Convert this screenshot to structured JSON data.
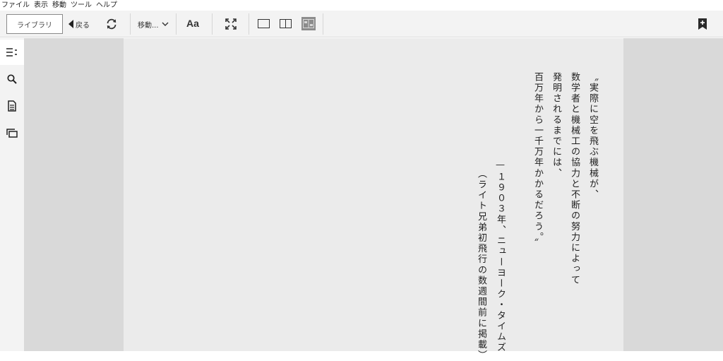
{
  "menu": [
    "ファイル",
    "表示",
    "移動",
    "ツール",
    "ヘルプ"
  ],
  "toolbar": {
    "library_label": "ライブラリ",
    "back_label": "戻る",
    "goto_label": "移動...",
    "font_label": "Aa"
  },
  "page_lines": {
    "line1": "〝実際に空を飛ぶ機械が、",
    "line2": "数学者と機械工の協力と不断の努力によって",
    "line3": "発明されるまでには、",
    "line4": "百万年から一千万年かかるだろう。〟",
    "line5": "—１９０３年、ニューヨーク・タイムズ",
    "line6": "（ライト兄弟初飛行の数週間前に掲載）"
  },
  "icons": {
    "back": "back-triangle-icon",
    "sync": "sync-icon",
    "goto": "chevron-down-icon",
    "fullscreen": "fullscreen-icon",
    "single_page": "single-page-layout-icon",
    "double_page": "double-page-layout-icon",
    "auto_layout": "auto-layout-icon",
    "bookmark": "add-bookmark-icon",
    "toc": "table-of-contents-icon",
    "search": "search-icon",
    "notes": "notes-icon",
    "pages": "pages-icon"
  }
}
